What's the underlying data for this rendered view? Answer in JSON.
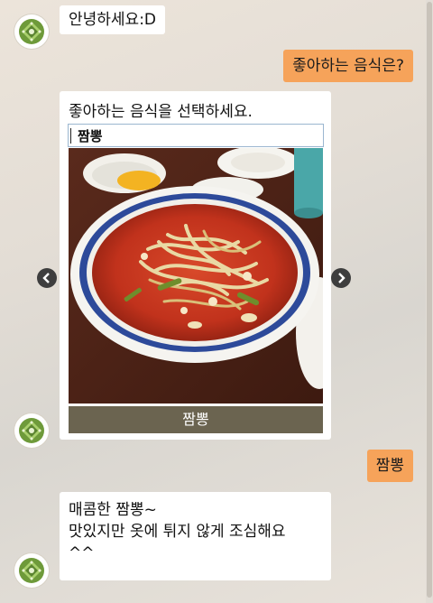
{
  "messages": [
    {
      "from": "bot",
      "text": "안녕하세요:D"
    },
    {
      "from": "user",
      "text": "좋아하는 음식은?"
    },
    {
      "from": "user",
      "text": "짬뽕"
    },
    {
      "from": "bot",
      "lines": [
        "매콤한 짬뽕~",
        "맛있지만 옷에 튀지 않게 조심해요",
        "^^"
      ]
    }
  ],
  "card": {
    "prompt": "좋아하는 음식을 선택하세요.",
    "input_value": "짬뽕",
    "image": "jjamppong-dish",
    "button_label": "짬뽕"
  },
  "icons": {
    "avatar": "bot-avatar-icon",
    "prev": "chevron-left-icon",
    "next": "chevron-right-icon"
  },
  "colors": {
    "user_bubble": "#f6a35a",
    "bot_bubble": "#ffffff",
    "card_button": "#6b6450",
    "avatar_pattern": "#6e9a3a"
  }
}
